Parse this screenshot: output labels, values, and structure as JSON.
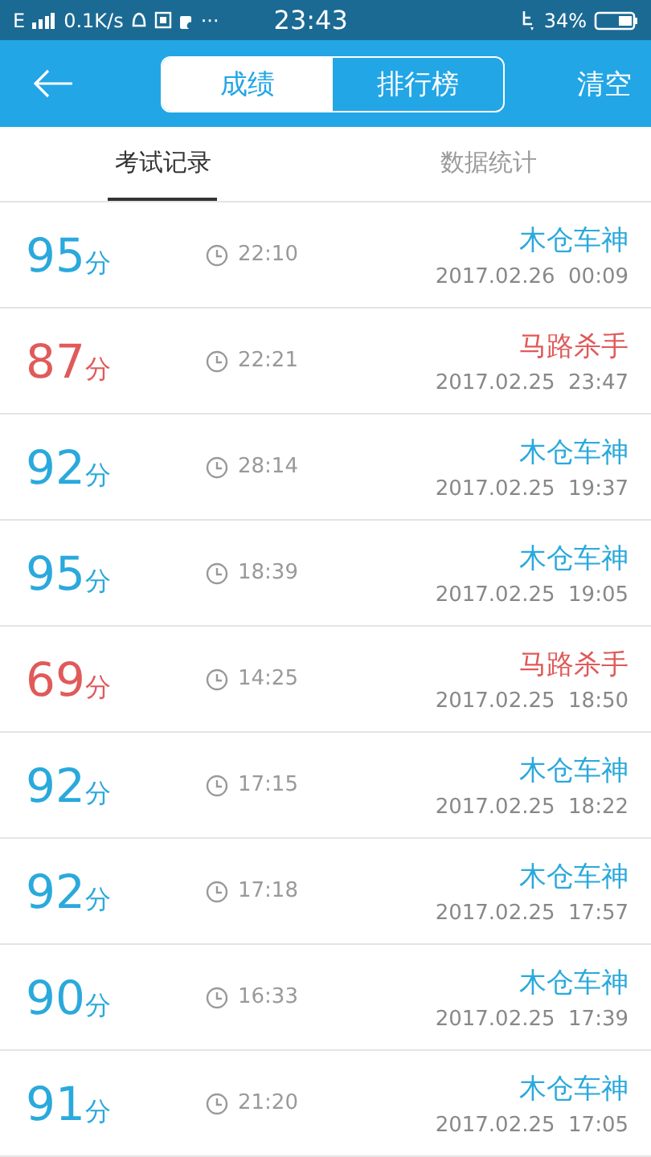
{
  "status_bar": {
    "network": "E",
    "speed": "0.1K/s",
    "more": "···",
    "time": "23:43",
    "battery": "34%"
  },
  "header": {
    "segments": [
      {
        "label": "成绩",
        "selected": true
      },
      {
        "label": "排行榜",
        "selected": false
      }
    ],
    "action": "清空"
  },
  "tabs": [
    {
      "label": "考试记录",
      "selected": true
    },
    {
      "label": "数据统计",
      "selected": false
    }
  ],
  "records": [
    {
      "score": "95",
      "unit": "分",
      "duration": "22:10",
      "title": "木仓车神",
      "date": "2017.02.26  00:09",
      "color": "#2aa9dc"
    },
    {
      "score": "87",
      "unit": "分",
      "duration": "22:21",
      "title": "马路杀手",
      "date": "2017.02.25  23:47",
      "color": "#e05a5a"
    },
    {
      "score": "92",
      "unit": "分",
      "duration": "28:14",
      "title": "木仓车神",
      "date": "2017.02.25  19:37",
      "color": "#2aa9dc"
    },
    {
      "score": "95",
      "unit": "分",
      "duration": "18:39",
      "title": "木仓车神",
      "date": "2017.02.25  19:05",
      "color": "#2aa9dc"
    },
    {
      "score": "69",
      "unit": "分",
      "duration": "14:25",
      "title": "马路杀手",
      "date": "2017.02.25  18:50",
      "color": "#e05a5a"
    },
    {
      "score": "92",
      "unit": "分",
      "duration": "17:15",
      "title": "木仓车神",
      "date": "2017.02.25  18:22",
      "color": "#2aa9dc"
    },
    {
      "score": "92",
      "unit": "分",
      "duration": "17:18",
      "title": "木仓车神",
      "date": "2017.02.25  17:57",
      "color": "#2aa9dc"
    },
    {
      "score": "90",
      "unit": "分",
      "duration": "16:33",
      "title": "木仓车神",
      "date": "2017.02.25  17:39",
      "color": "#2aa9dc"
    },
    {
      "score": "91",
      "unit": "分",
      "duration": "21:20",
      "title": "木仓车神",
      "date": "2017.02.25  17:05",
      "color": "#2aa9dc"
    }
  ]
}
